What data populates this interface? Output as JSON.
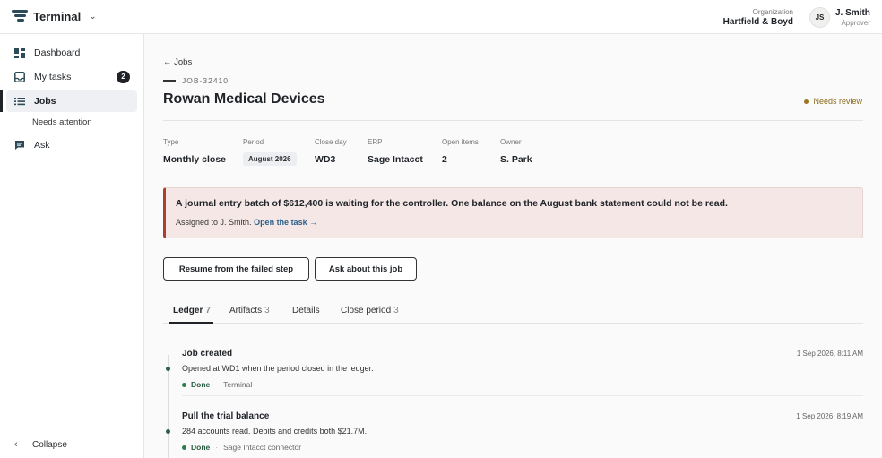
{
  "app": {
    "name": "Terminal"
  },
  "header": {
    "org_label": "Organization",
    "org_name": "Hartfield & Boyd",
    "user_initials": "JS",
    "user_name": "J. Smith",
    "user_role": "Approver"
  },
  "sidebar": {
    "items": [
      {
        "label": "Dashboard",
        "icon": "dashboard-icon"
      },
      {
        "label": "My tasks",
        "icon": "inbox-icon",
        "badge": "2"
      },
      {
        "label": "Jobs",
        "icon": "list-icon",
        "active": true
      },
      {
        "label": "Ask",
        "icon": "chat-icon"
      }
    ],
    "sub_item": "Needs attention",
    "collapse_label": "Collapse"
  },
  "job": {
    "back_label": "← Jobs",
    "id": "JOB-32410",
    "title": "Rowan Medical Devices",
    "status": "Needs review",
    "status_color": "#9a7620",
    "meta": [
      {
        "label": "Type",
        "value": "Monthly close"
      },
      {
        "label": "Period",
        "value": "August 2026"
      },
      {
        "label": "Close day",
        "value": "WD3"
      },
      {
        "label": "ERP",
        "value": "Sage Intacct"
      },
      {
        "label": "Open items",
        "value": "2"
      },
      {
        "label": "Owner",
        "value": "S. Park"
      }
    ]
  },
  "alert": {
    "title": "A journal entry batch of $612,400 is waiting for the controller. One balance on the August bank statement could not be read.",
    "assigned": "Assigned to J. Smith.",
    "link": "Open the task →",
    "accent_color": "#a8402f"
  },
  "actions": {
    "resume": "Resume from the failed step",
    "ask": "Ask about this job"
  },
  "tabs": [
    {
      "label": "Ledger",
      "count": "7"
    },
    {
      "label": "Artifacts",
      "count": "3"
    },
    {
      "label": "Details",
      "count": ""
    },
    {
      "label": "Close period",
      "count": "3"
    }
  ],
  "events": [
    {
      "title": "Job created",
      "time": "1 Sep 2026, 8:11 AM",
      "desc": "Opened at WD1 when the period closed in the ledger.",
      "status": "Done",
      "source": "Terminal"
    },
    {
      "title": "Pull the trial balance",
      "time": "1 Sep 2026, 8:19 AM",
      "desc": "284 accounts read. Debits and credits both $21.7M.",
      "status": "Done",
      "source": "Sage Intacct connector"
    }
  ]
}
